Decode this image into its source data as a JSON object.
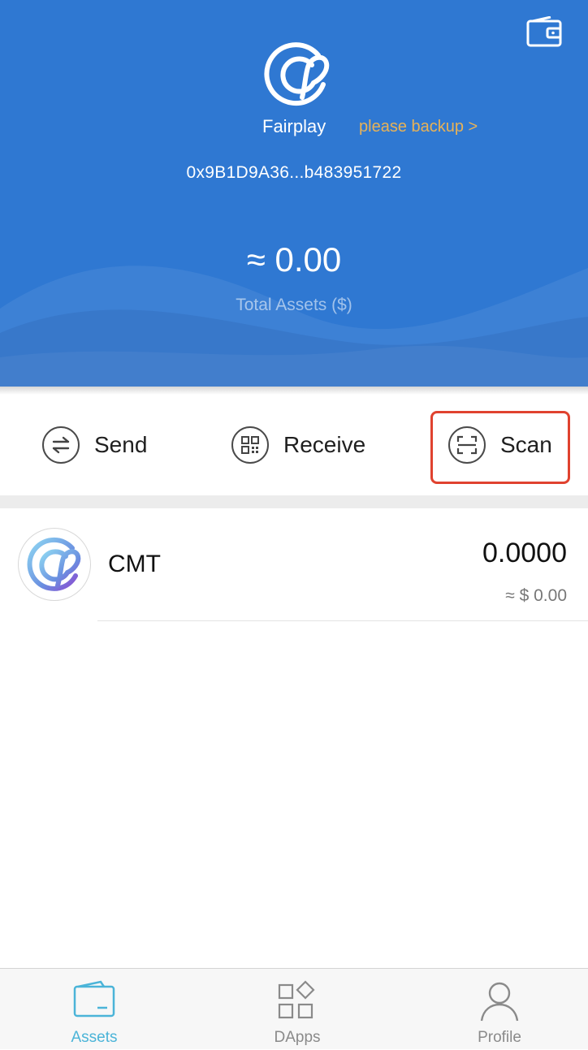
{
  "header": {
    "wallet_name": "Fairplay",
    "backup_link": "please backup >",
    "address": "0x9B1D9A36...b483951722",
    "total_value": "≈ 0.00",
    "total_label": "Total Assets ($)",
    "bg_color": "#2f78d2",
    "wallet_icon": "wallet-icon",
    "logo_icon": "cmt-logo-icon"
  },
  "actions": [
    {
      "label": "Send",
      "icon": "swap-arrows-icon"
    },
    {
      "label": "Receive",
      "icon": "qr-code-icon"
    },
    {
      "label": "Scan",
      "icon": "scan-frame-icon",
      "highlighted": true
    }
  ],
  "tokens": [
    {
      "symbol": "CMT",
      "balance": "0.0000",
      "value": "≈ $ 0.00",
      "icon": "cmt-token-icon"
    }
  ],
  "tabbar": {
    "tabs": [
      {
        "label": "Assets",
        "icon": "assets-wallet-icon",
        "active": true
      },
      {
        "label": "DApps",
        "icon": "dapps-grid-icon",
        "active": false
      },
      {
        "label": "Profile",
        "icon": "profile-person-icon",
        "active": false
      }
    ],
    "active_color": "#4bb4d8",
    "inactive_color": "#8a8a8a"
  },
  "colors": {
    "highlight": "#e0422f",
    "backup": "#e8b257"
  }
}
